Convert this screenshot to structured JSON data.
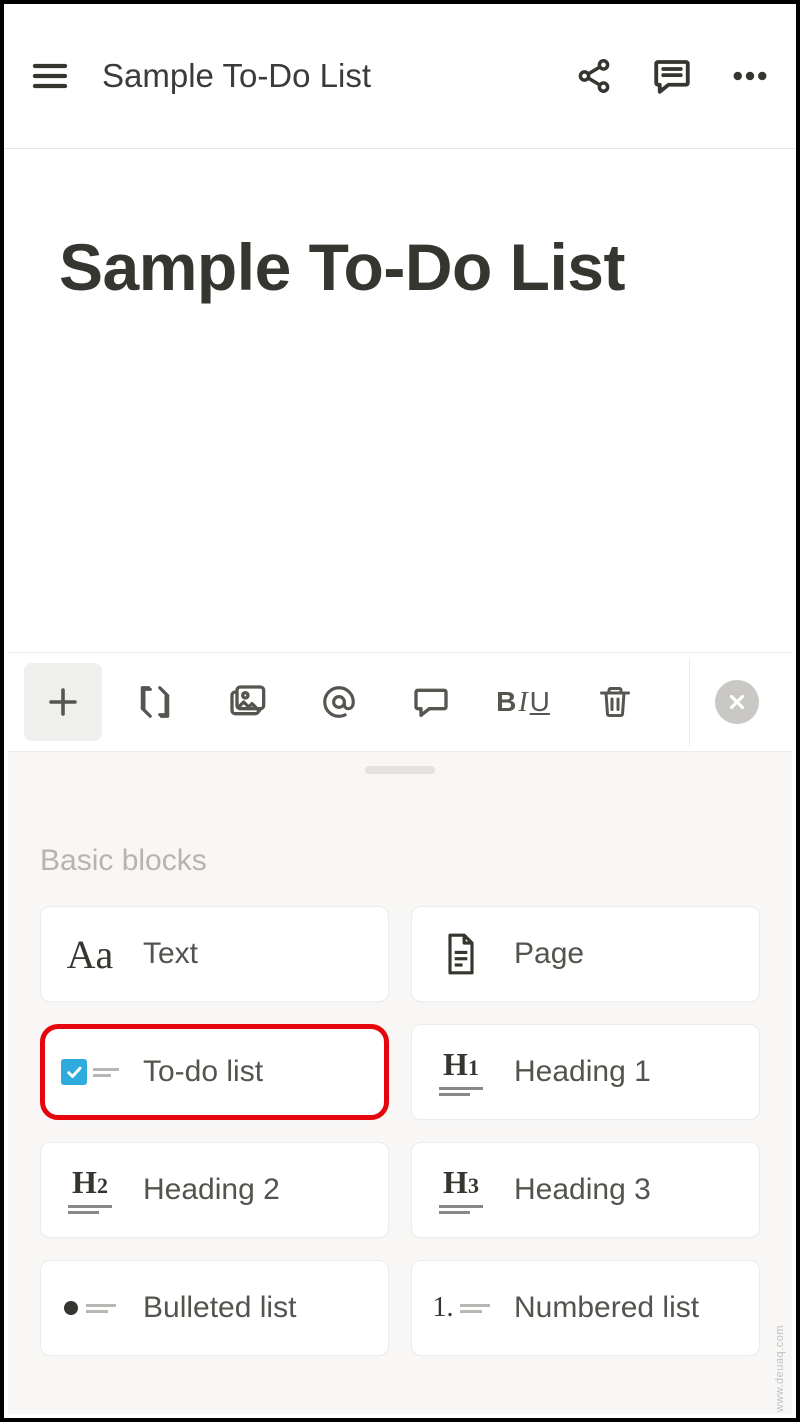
{
  "header": {
    "title": "Sample To-Do List"
  },
  "page": {
    "heading": "Sample To-Do List"
  },
  "toolbar": {
    "add": "+",
    "format_biu": {
      "b": "B",
      "i": "I",
      "u": "U"
    }
  },
  "sheet": {
    "section_label": "Basic blocks",
    "blocks": [
      {
        "id": "text",
        "label": "Text",
        "highlighted": false
      },
      {
        "id": "page",
        "label": "Page",
        "highlighted": false
      },
      {
        "id": "todo",
        "label": "To-do list",
        "highlighted": true
      },
      {
        "id": "h1",
        "label": "Heading 1",
        "highlighted": false
      },
      {
        "id": "h2",
        "label": "Heading 2",
        "highlighted": false
      },
      {
        "id": "h3",
        "label": "Heading 3",
        "highlighted": false
      },
      {
        "id": "bulleted",
        "label": "Bulleted list",
        "highlighted": false
      },
      {
        "id": "numbered",
        "label": "Numbered list",
        "highlighted": false
      }
    ]
  },
  "watermark": "www.deuaq.com"
}
